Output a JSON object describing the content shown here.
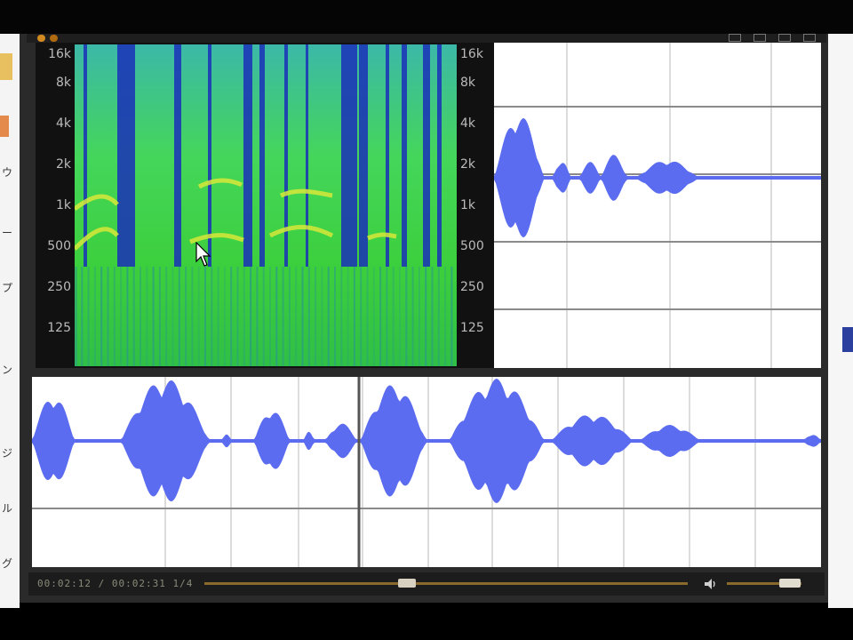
{
  "spectrogram": {
    "freq_labels_left": [
      "16k",
      "8k",
      "4k",
      "2k",
      "1k",
      "500",
      "250",
      "125"
    ],
    "freq_labels_right": [
      "16k",
      "8k",
      "4k",
      "2k",
      "1k",
      "500",
      "250",
      "125"
    ]
  },
  "transport": {
    "time_readout": "00:02:12 / 00:02:31  1/4",
    "seek_position": 0.42,
    "volume_level": 0.85
  },
  "left_margin_glyphs": [
    "ウ",
    "ー",
    "プ",
    "ン",
    "ジ",
    "ル",
    "グ"
  ],
  "colors": {
    "waveform": "#5b6cf0",
    "spectrogram_base": "#3cd63c",
    "spectrogram_dark": "#1a2fb8",
    "accent": "#8a6a2c"
  }
}
